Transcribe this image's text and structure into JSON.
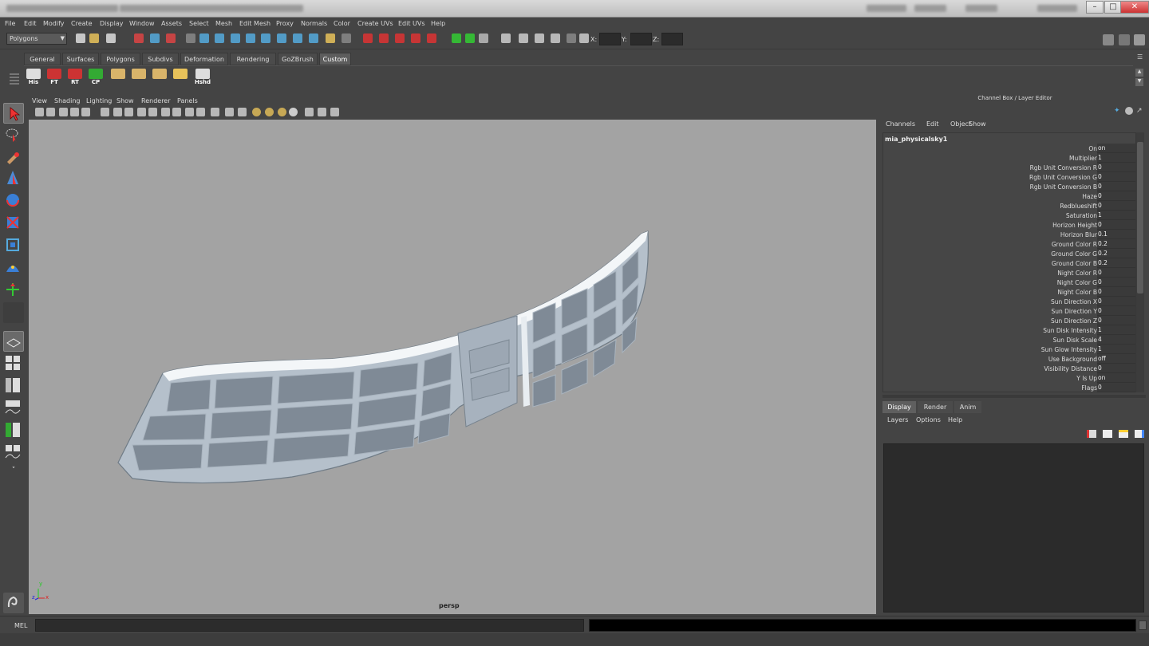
{
  "menu": [
    "File",
    "Edit",
    "Modify",
    "Create",
    "Display",
    "Window",
    "Assets",
    "Select",
    "Mesh",
    "Edit Mesh",
    "Proxy",
    "Normals",
    "Color",
    "Create UVs",
    "Edit UVs",
    "Help"
  ],
  "status": {
    "mode_selector": "Polygons",
    "x_label": "X:",
    "y_label": "Y:",
    "z_label": "Z:",
    "x_value": "",
    "y_value": "",
    "z_value": ""
  },
  "shelf": {
    "tabs": [
      "General",
      "Surfaces",
      "Polygons",
      "Subdivs",
      "Deformation",
      "Rendering",
      "GoZBrush",
      "Custom"
    ],
    "active_tab": "Custom",
    "buttons": [
      {
        "label": "His",
        "icon": "history-icon"
      },
      {
        "label": "FT",
        "icon": "freeze-transform-icon"
      },
      {
        "label": "RT",
        "icon": "reset-transform-icon"
      },
      {
        "label": "CP",
        "icon": "center-pivot-icon"
      },
      {
        "label": "",
        "icon": "plane-tool-icon"
      },
      {
        "label": "",
        "icon": "plane-tool-icon"
      },
      {
        "label": "",
        "icon": "plane-edit-icon"
      },
      {
        "label": "",
        "icon": "uv-layout-icon"
      },
      {
        "label": "Hshd",
        "icon": "hardness-shading-icon"
      }
    ]
  },
  "viewport": {
    "menu": [
      "View",
      "Shading",
      "Lighting",
      "Show",
      "Renderer",
      "Panels"
    ],
    "camera_label": "persp",
    "axis_labels": {
      "x": "x",
      "y": "y",
      "z": "z"
    }
  },
  "channel_box": {
    "title": "Channel Box / Layer Editor",
    "menu": [
      "Channels",
      "Edit",
      "Object",
      "Show"
    ],
    "node_name": "mia_physicalsky1",
    "attributes": [
      {
        "name": "On",
        "value": "on"
      },
      {
        "name": "Multiplier",
        "value": "1"
      },
      {
        "name": "Rgb Unit Conversion R",
        "value": "0"
      },
      {
        "name": "Rgb Unit Conversion G",
        "value": "0"
      },
      {
        "name": "Rgb Unit Conversion B",
        "value": "0"
      },
      {
        "name": "Haze",
        "value": "0"
      },
      {
        "name": "Redblueshift",
        "value": "0"
      },
      {
        "name": "Saturation",
        "value": "1"
      },
      {
        "name": "Horizon Height",
        "value": "0"
      },
      {
        "name": "Horizon Blur",
        "value": "0.1"
      },
      {
        "name": "Ground Color R",
        "value": "0.2"
      },
      {
        "name": "Ground Color G",
        "value": "0.2"
      },
      {
        "name": "Ground Color B",
        "value": "0.2"
      },
      {
        "name": "Night Color R",
        "value": "0"
      },
      {
        "name": "Night Color G",
        "value": "0"
      },
      {
        "name": "Night Color B",
        "value": "0"
      },
      {
        "name": "Sun Direction X",
        "value": "0"
      },
      {
        "name": "Sun Direction Y",
        "value": "0"
      },
      {
        "name": "Sun Direction Z",
        "value": "0"
      },
      {
        "name": "Sun Disk Intensity",
        "value": "1"
      },
      {
        "name": "Sun Disk Scale",
        "value": "4"
      },
      {
        "name": "Sun Glow Intensity",
        "value": "1"
      },
      {
        "name": "Use Background",
        "value": "off"
      },
      {
        "name": "Visibility Distance",
        "value": "0"
      },
      {
        "name": "Y Is Up",
        "value": "on"
      },
      {
        "name": "Flags",
        "value": "0"
      }
    ]
  },
  "layer_editor": {
    "tabs": [
      "Display",
      "Render",
      "Anim"
    ],
    "active_tab": "Display",
    "menu": [
      "Layers",
      "Options",
      "Help"
    ]
  },
  "command_line": {
    "label": "MEL",
    "input_value": ""
  },
  "colors": {
    "ui_bg": "#444444",
    "viewport_bg": "#a3a3a3",
    "model_fill": "#a9b4c0"
  }
}
